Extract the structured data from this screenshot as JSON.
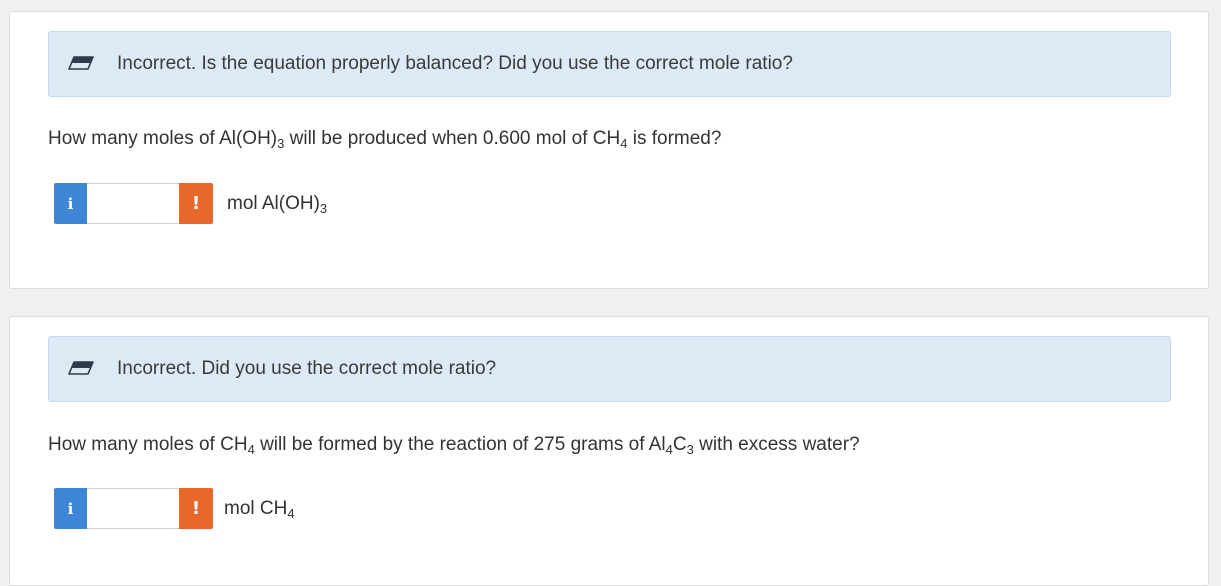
{
  "colors": {
    "feedback_bg": "#ddeaf6",
    "info_button": "#3f86d6",
    "warning_badge": "#e8672a"
  },
  "icons": {
    "feedback": "eraser-icon",
    "info": "info-icon",
    "warning": "exclamation-icon"
  },
  "question1": {
    "feedback": "Incorrect. Is the equation properly balanced? Did you use the correct mole ratio?",
    "text_part1": "How many moles of Al(OH)",
    "text_sub1": "3",
    "text_part2": " will be produced when 0.600 mol of CH",
    "text_sub2": "4",
    "text_part3": " is formed?",
    "info_symbol": "i",
    "answer_value": "",
    "warning_symbol": "!",
    "unit_main": "mol Al(OH)",
    "unit_sub": "3"
  },
  "question2": {
    "feedback": "Incorrect. Did you use the correct mole ratio?",
    "text_part1": "How many moles of CH",
    "text_sub1": "4",
    "text_part2": " will be formed by the reaction of 275 grams of Al",
    "text_sub2": "4",
    "text_part3": "C",
    "text_sub3": "3",
    "text_part4": " with excess water?",
    "info_symbol": "i",
    "answer_value": "",
    "warning_symbol": "!",
    "unit_main": "mol CH",
    "unit_sub": "4"
  }
}
